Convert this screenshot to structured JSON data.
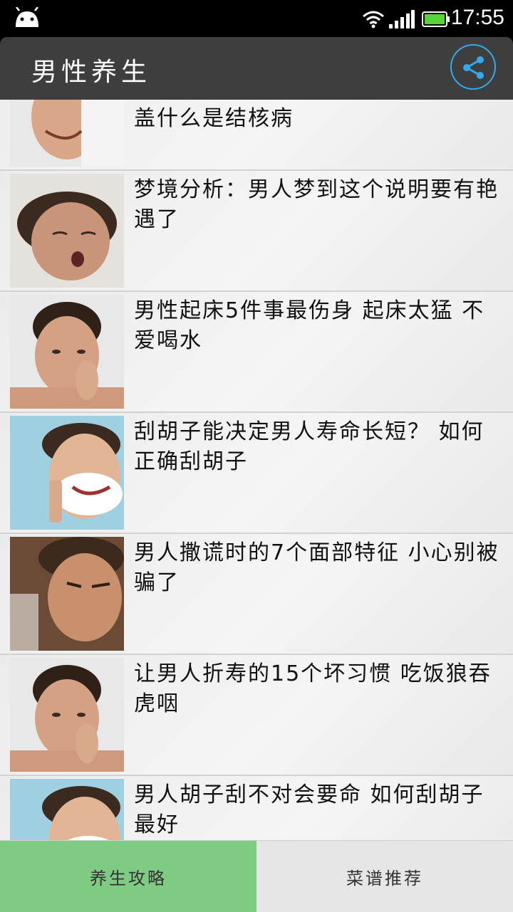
{
  "status_bar": {
    "time": "17:55"
  },
  "app_bar": {
    "title": "男性养生"
  },
  "list": {
    "items": [
      {
        "title": "盖什么是结核病"
      },
      {
        "title": "梦境分析：男人梦到这个说明要有艳遇了"
      },
      {
        "title": "男性起床5件事最伤身 起床太猛 不爱喝水"
      },
      {
        "title": "刮胡子能决定男人寿命长短？ 如何正确刮胡子"
      },
      {
        "title": "男人撒谎时的7个面部特征 小心别被骗了"
      },
      {
        "title": "让男人折寿的15个坏习惯 吃饭狼吞虎咽"
      },
      {
        "title": "男人胡子刮不对会要命 如何刮胡子最好"
      }
    ]
  },
  "tabs": {
    "active": "养生攻略",
    "inactive": "菜谱推荐"
  },
  "colors": {
    "app_bar": "#3e3e3e",
    "active_tab": "#7fcb84",
    "share_accent": "#33aaf0"
  }
}
